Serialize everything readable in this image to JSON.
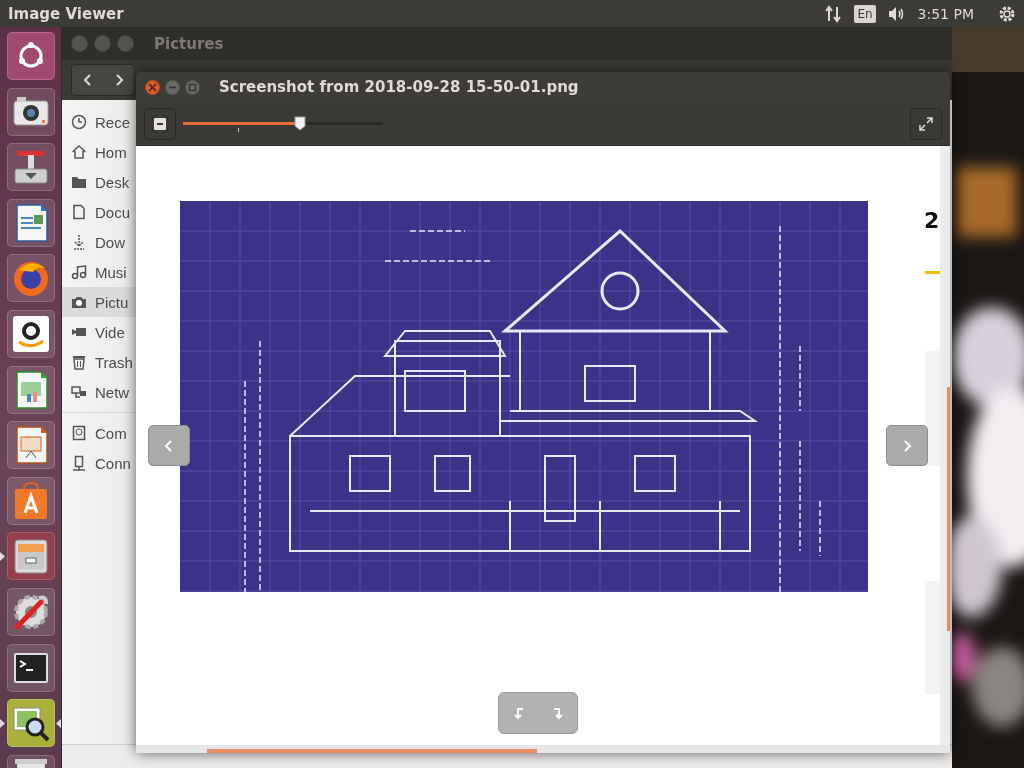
{
  "top_bar": {
    "app_name": "Image Viewer",
    "keyboard_layout": "En",
    "clock": "3:51 PM"
  },
  "launcher": {
    "items": [
      {
        "kind": "dash",
        "running": false,
        "focused": false
      },
      {
        "kind": "camera",
        "running": false,
        "focused": false
      },
      {
        "kind": "installer",
        "running": false,
        "focused": false
      },
      {
        "kind": "writer",
        "running": false,
        "focused": false
      },
      {
        "kind": "browser",
        "running": false,
        "focused": false
      },
      {
        "kind": "store",
        "running": false,
        "focused": false
      },
      {
        "kind": "calc",
        "running": false,
        "focused": false
      },
      {
        "kind": "impress",
        "running": false,
        "focused": false
      },
      {
        "kind": "software",
        "running": false,
        "focused": false
      },
      {
        "kind": "files",
        "running": true,
        "focused": false
      },
      {
        "kind": "settings",
        "running": false,
        "focused": false
      },
      {
        "kind": "terminal",
        "running": false,
        "focused": false
      },
      {
        "kind": "viewer",
        "running": true,
        "focused": true
      },
      {
        "kind": "trash",
        "running": false,
        "focused": false
      }
    ]
  },
  "file_manager": {
    "title": "Pictures",
    "places": [
      {
        "kind": "recent",
        "label": "Rece",
        "selected": false
      },
      {
        "kind": "home",
        "label": "Hom",
        "selected": false
      },
      {
        "kind": "desktop",
        "label": "Desk",
        "selected": false
      },
      {
        "kind": "documents",
        "label": "Docu",
        "selected": false
      },
      {
        "kind": "downloads",
        "label": "Dow",
        "selected": false
      },
      {
        "kind": "music",
        "label": "Musi",
        "selected": false
      },
      {
        "kind": "pictures",
        "label": "Pictu",
        "selected": true
      },
      {
        "kind": "videos",
        "label": "Vide",
        "selected": false
      },
      {
        "kind": "trash",
        "label": "Trash",
        "selected": false
      },
      {
        "kind": "network",
        "label": "Netw",
        "selected": false
      }
    ],
    "devices": [
      {
        "kind": "computer",
        "label": "Com",
        "selected": false
      },
      {
        "kind": "server",
        "label": "Conn",
        "selected": false
      }
    ]
  },
  "viewer": {
    "title": "Screenshot from 2018-09-28 15-50-01.png",
    "zoom": {
      "level": 0.585
    },
    "image": {
      "side_text": "2"
    }
  }
}
